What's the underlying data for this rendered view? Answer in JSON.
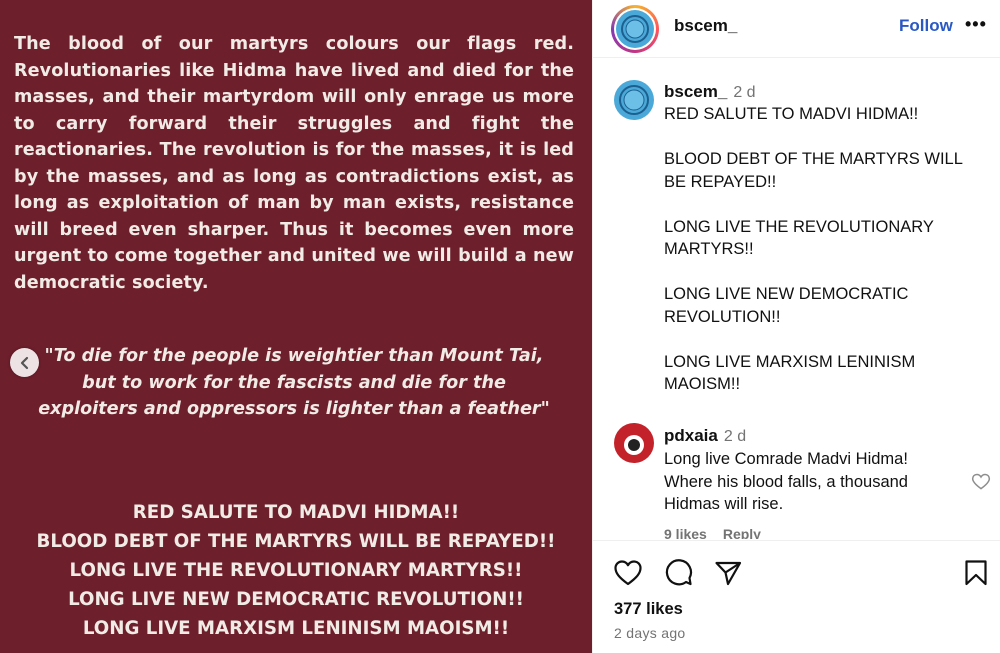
{
  "post": {
    "paragraph": "The blood of our martyrs colours our flags red. Revolutionaries like Hidma have lived and died for the masses, and their martyrdom will only enrage  us more to carry forward their struggles and fight the reactionaries. The revolution is for the masses, it is led by the masses, and as long as contradictions exist, as long as exploitation of man by man exists, resistance will breed even sharper. Thus it becomes even more urgent to come together and united we will build a new democratic society.",
    "quote": "\"To die for the people is weightier than Mount Tai, but to work for the fascists and die for the exploiters and oppressors is lighter than a feather\"",
    "slogans": [
      "RED SALUTE TO MADVI HIDMA!!",
      "BLOOD DEBT OF THE MARTYRS WILL BE REPAYED!!",
      "LONG LIVE THE REVOLUTIONARY MARTYRS!!",
      "LONG LIVE NEW DEMOCRATIC REVOLUTION!!",
      "LONG LIVE MARXISM LENINISM MAOISM!!"
    ],
    "background_color": "#6e1f2c"
  },
  "header": {
    "username": "bscem_",
    "follow_label": "Follow",
    "more_label": "•••"
  },
  "caption": {
    "username": "bscem_",
    "time": "2 d",
    "text": "RED SALUTE TO MADVI HIDMA!!\n\nBLOOD DEBT OF THE MARTYRS WILL BE REPAYED!!\n\nLONG LIVE THE REVOLUTIONARY MARTYRS!!\n\nLONG LIVE NEW DEMOCRATIC REVOLUTION!!\n\nLONG LIVE MARXISM LENINISM MAOISM!!"
  },
  "comment": {
    "username": "pdxaia",
    "time": "2 d",
    "text": "Long live Comrade Madvi Hidma! Where his blood falls, a thousand Hidmas will rise.",
    "likes": "9 likes",
    "reply_label": "Reply"
  },
  "actions": {
    "likes_count": "377 likes",
    "time_ago": "2 days ago"
  },
  "icons": [
    "chevron-left-icon",
    "heart-icon",
    "comment-icon",
    "share-icon",
    "bookmark-icon",
    "more-icon"
  ],
  "colors": {
    "link": "#2b59c3",
    "muted": "#737373",
    "avatar_blue": "#4aa9d8"
  }
}
